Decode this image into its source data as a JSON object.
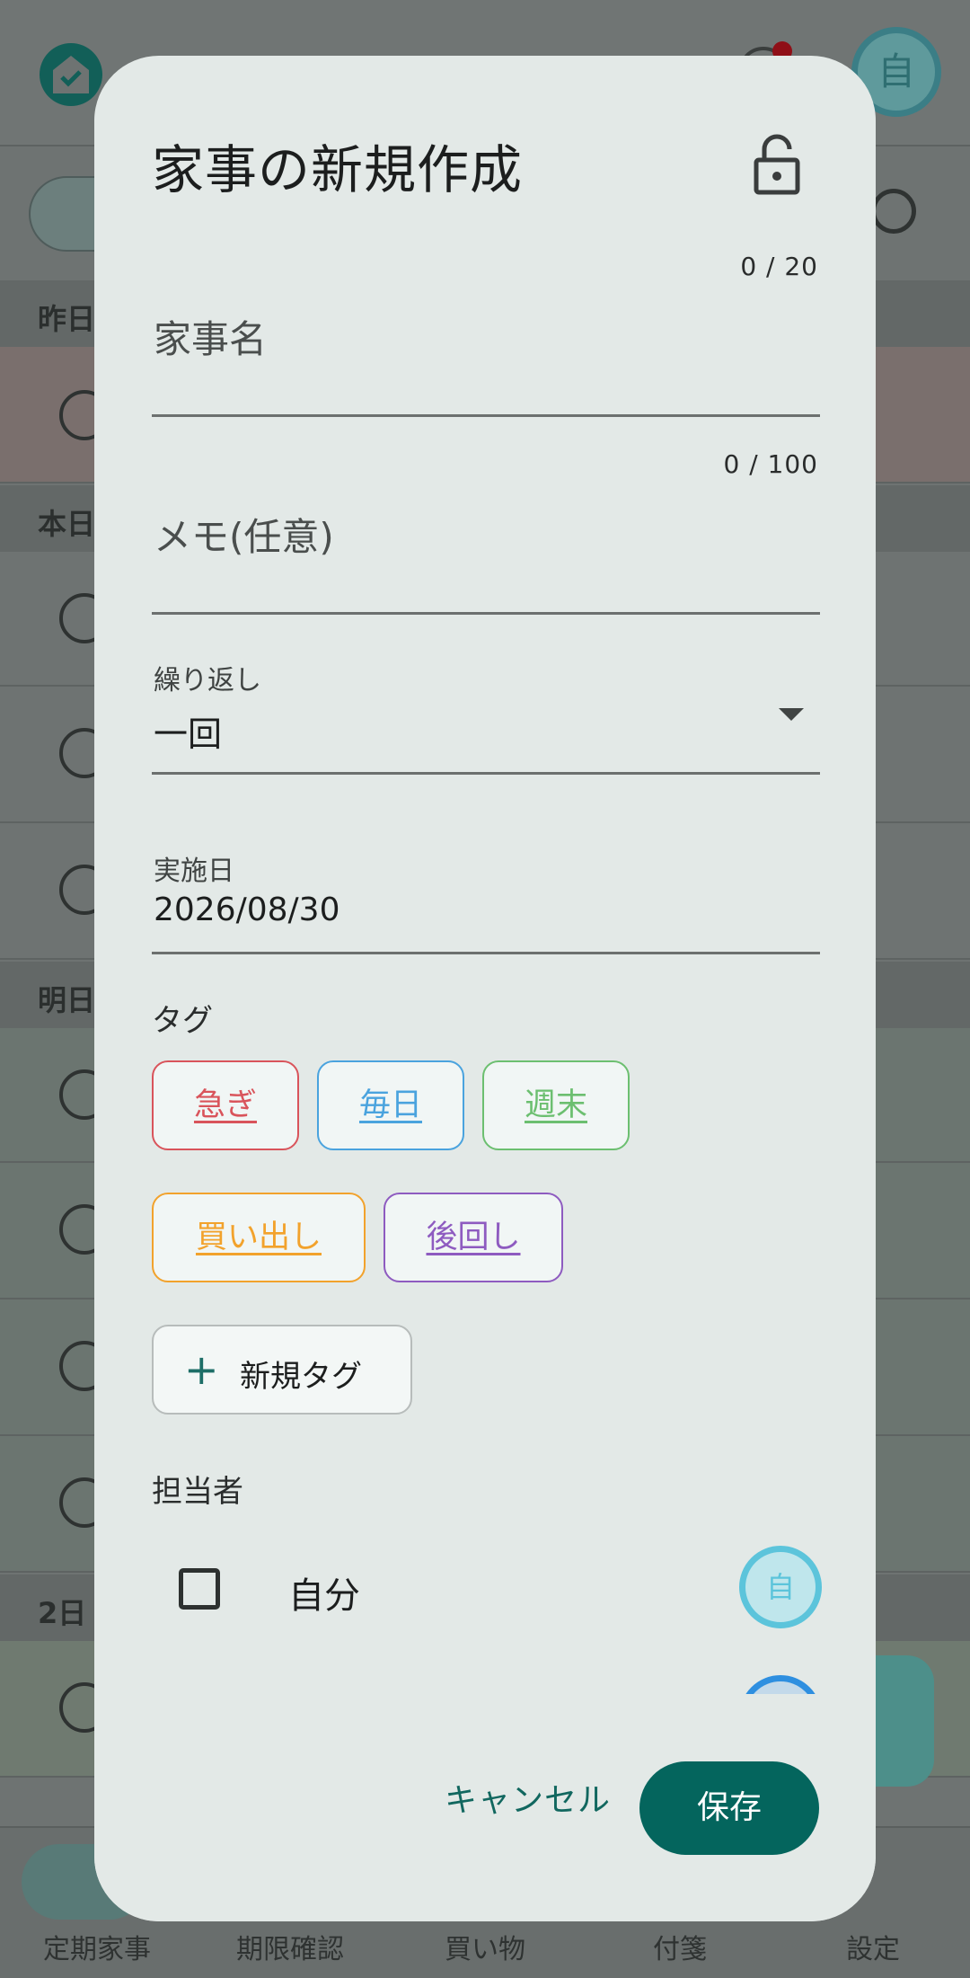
{
  "background": {
    "avatar_initial": "自",
    "sections": [
      "昨日",
      "本日",
      "明日",
      "2日"
    ],
    "bottom_nav": [
      "定期家事",
      "期限確認",
      "買い物",
      "付箋",
      "設定"
    ]
  },
  "dialog": {
    "title": "家事の新規作成",
    "name_counter": "0 / 20",
    "name_placeholder": "家事名",
    "memo_counter": "0 / 100",
    "memo_placeholder": "メモ(任意)",
    "repeat_label": "繰り返し",
    "repeat_value": "一回",
    "date_label": "実施日",
    "date_value": "2026/08/30",
    "tags_label": "タグ",
    "tags": [
      {
        "label": "急ぎ",
        "color": "#d9545b"
      },
      {
        "label": "毎日",
        "color": "#4aa3de"
      },
      {
        "label": "週末",
        "color": "#6cbf70"
      },
      {
        "label": "買い出し",
        "color": "#f2a22c"
      },
      {
        "label": "後回し",
        "color": "#8e5bc0"
      }
    ],
    "new_tag_label": "新規タグ",
    "assignee_label": "担当者",
    "assignee_name": "自分",
    "assignee_initial": "自",
    "cancel_label": "キャンセル",
    "save_label": "保存",
    "accent_color": "#04655d"
  }
}
